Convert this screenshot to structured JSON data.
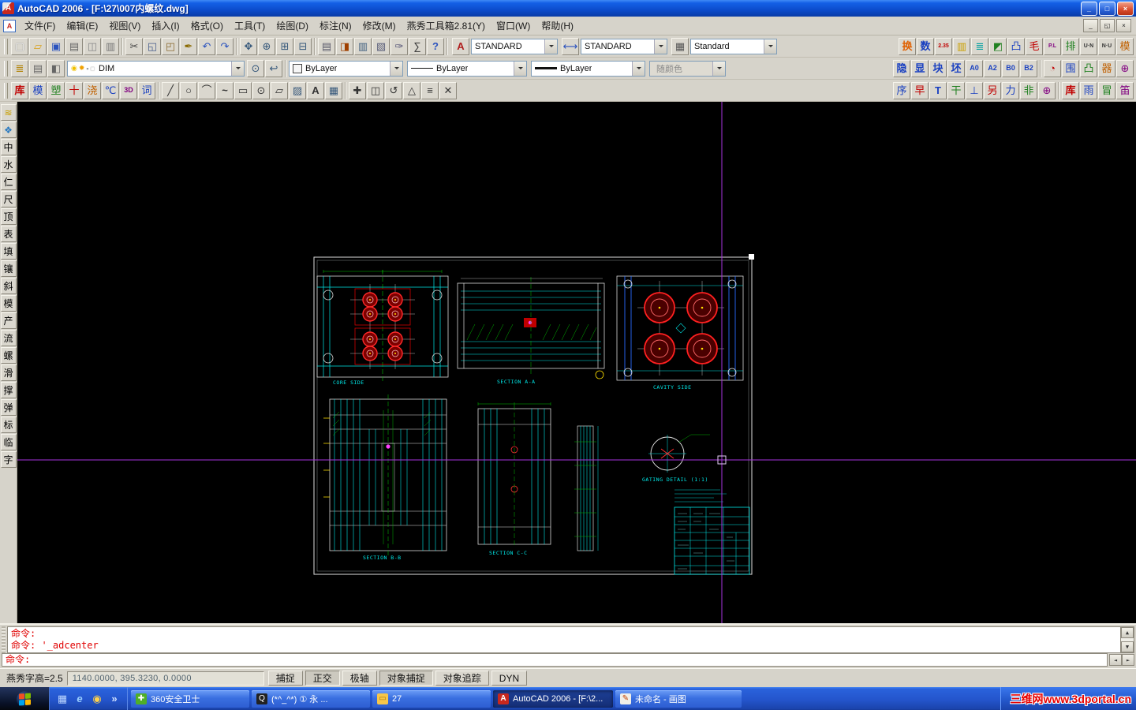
{
  "titlebar": {
    "title": "AutoCAD 2006 - [F:\\27\\007内螺纹.dwg]",
    "app_icon_letter": "A",
    "minimize": "_",
    "maximize": "□",
    "close": "×"
  },
  "menubar": {
    "items": [
      "文件(F)",
      "编辑(E)",
      "视图(V)",
      "插入(I)",
      "格式(O)",
      "工具(T)",
      "绘图(D)",
      "标注(N)",
      "修改(M)",
      "燕秀工具箱2.81(Y)",
      "窗口(W)",
      "帮助(H)"
    ],
    "doc_buttons": [
      {
        "name": "doc-minimize-button",
        "glyph": "_"
      },
      {
        "name": "doc-restore-button",
        "glyph": "◱"
      },
      {
        "name": "doc-close-button",
        "glyph": "×"
      }
    ]
  },
  "toolbars": {
    "row1": {
      "file": [
        {
          "name": "new-file-icon",
          "glyph": "▢",
          "style": "color:#fff;text-shadow:0 0 1px #444"
        },
        {
          "name": "open-folder-icon",
          "glyph": "▱",
          "style": "color:#d8a018"
        },
        {
          "name": "save-icon",
          "glyph": "▣",
          "style": "color:#2a52be"
        },
        {
          "name": "plot-icon",
          "glyph": "▤",
          "style": "color:#666"
        },
        {
          "name": "plot-preview-icon",
          "glyph": "◫",
          "style": "color:#888"
        },
        {
          "name": "publish-icon",
          "glyph": "▥",
          "style": "color:#777"
        }
      ],
      "edit": [
        {
          "name": "cut-icon",
          "glyph": "✂",
          "style": "color:#444"
        },
        {
          "name": "copy-icon",
          "glyph": "◱",
          "style": "color:#445a8a"
        },
        {
          "name": "paste-icon",
          "glyph": "◰",
          "style": "color:#8a6a30"
        },
        {
          "name": "match-properties-icon",
          "glyph": "✒",
          "style": "color:#8a6a00"
        },
        {
          "name": "undo-icon",
          "glyph": "↶",
          "style": "color:#2a52be"
        },
        {
          "name": "redo-icon",
          "glyph": "↷",
          "style": "color:#2a52be"
        }
      ],
      "zoom": [
        {
          "name": "pan-icon",
          "glyph": "✥",
          "style": "color:#35577a"
        },
        {
          "name": "zoom-realtime-icon",
          "glyph": "⊕",
          "style": "color:#35577a"
        },
        {
          "name": "zoom-window-icon",
          "glyph": "⊞",
          "style": "color:#35577a"
        },
        {
          "name": "zoom-previous-icon",
          "glyph": "⊟",
          "style": "color:#35577a"
        }
      ],
      "palettes": [
        {
          "name": "properties-palette-icon",
          "glyph": "▤",
          "style": "color:#5a5a6a"
        },
        {
          "name": "designcenter-icon",
          "glyph": "◨",
          "style": "color:#a04000"
        },
        {
          "name": "tool-palettes-icon",
          "glyph": "▥",
          "style": "color:#406080"
        },
        {
          "name": "sheet-set-manager-icon",
          "glyph": "▧",
          "style": "color:#555a77"
        },
        {
          "name": "markup-set-manager-icon",
          "glyph": "✑",
          "style": "color:#557"
        },
        {
          "name": "quickcalc-icon",
          "glyph": "∑",
          "style": "color:#333"
        },
        {
          "name": "help-icon",
          "glyph": "?",
          "style": "color:#2a52be;font-weight:bold"
        }
      ],
      "combos": [
        {
          "name": "text-style-combo",
          "icon": "text-style-icon",
          "glyph": "A",
          "istyle": "color:#b02020;font-weight:bold",
          "value": "STANDARD"
        },
        {
          "name": "dim-style-combo",
          "icon": "dim-style-icon",
          "glyph": "⟷",
          "istyle": "color:#2a52be",
          "value": "STANDARD"
        },
        {
          "name": "table-style-combo",
          "icon": "table-style-icon",
          "glyph": "▦",
          "istyle": "color:#555",
          "value": "Standard"
        }
      ],
      "yanxiu": [
        {
          "name": "yanxiu-swap-icon",
          "glyph": "换",
          "style": "color:#e06000;font-weight:bold"
        },
        {
          "name": "yanxiu-count-icon",
          "glyph": "数",
          "style": "color:#1a40c0;font-weight:bold"
        },
        {
          "name": "yanxiu-scale-icon",
          "glyph": "2.35",
          "style": "font-size:7px;color:#c00000;font-weight:bold"
        },
        {
          "name": "yanxiu-palette-icon",
          "glyph": "▥",
          "style": "color:#caa000"
        },
        {
          "name": "yanxiu-list-icon",
          "glyph": "≣",
          "style": "color:#00a0a0"
        },
        {
          "name": "yanxiu-corner-icon",
          "glyph": "◩",
          "style": "color:#208020"
        },
        {
          "name": "yanxiu-boss-icon",
          "glyph": "凸",
          "style": "color:#1a40c0"
        },
        {
          "name": "yanxiu-burr-icon",
          "glyph": "毛",
          "style": "color:#c00000"
        },
        {
          "name": "yanxiu-parting-line-icon",
          "glyph": "P.L",
          "style": "font-size:7px;color:#800080;font-weight:bold"
        },
        {
          "name": "yanxiu-layout-icon",
          "glyph": "排",
          "style": "color:#208020"
        },
        {
          "name": "yanxiu-un-icon",
          "glyph": "U·N",
          "style": "font-size:7px;color:#333;font-weight:bold"
        },
        {
          "name": "yanxiu-nu-icon",
          "glyph": "N·U",
          "style": "font-size:7px;color:#333;font-weight:bold"
        },
        {
          "name": "yanxiu-mold-icon",
          "glyph": "模",
          "style": "color:#c06000"
        }
      ]
    },
    "row2": {
      "layer_tools": [
        {
          "name": "layer-properties-manager-icon",
          "glyph": "≣",
          "style": "color:#b08000"
        },
        {
          "name": "layer-states-icon",
          "glyph": "▤",
          "style": "color:#666"
        },
        {
          "name": "layer-filter-icon",
          "glyph": "◧",
          "style": "color:#666"
        }
      ],
      "layer_combo": {
        "value": "DIM",
        "icons": [
          {
            "name": "layer-on-icon",
            "glyph": "◉",
            "style": "color:#f0c000"
          },
          {
            "name": "layer-freeze-icon",
            "glyph": "✹",
            "style": "color:#f0a000"
          },
          {
            "name": "layer-lock-icon",
            "glyph": "▪",
            "style": "color:#98a0a8"
          },
          {
            "name": "layer-color-chip",
            "glyph": "■",
            "style": "color:#fdfdfd;text-shadow:0 0 1px #333"
          }
        ]
      },
      "post_icons": [
        {
          "name": "make-object-layer-current-icon",
          "glyph": "⊙",
          "style": "color:#35577a"
        },
        {
          "name": "layer-previous-icon",
          "glyph": "↩",
          "style": "color:#35577a"
        }
      ],
      "prop_combos": [
        {
          "name": "color-combo",
          "chip": "",
          "chipstyle": "width:10px;height:10px;background:#f6f6f6;border:1px solid #444",
          "value": "ByLayer",
          "w": "width:145px",
          "state": "normal"
        },
        {
          "name": "linetype-combo",
          "chip": "",
          "chipstyle": "width:28px;height:0;border-top:1px solid #111",
          "value": "ByLayer",
          "w": "width:152px",
          "state": "normal"
        },
        {
          "name": "lineweight-combo",
          "chip": "",
          "chipstyle": "width:28px;height:3px;background:#111",
          "value": "ByLayer",
          "w": "width:145px",
          "state": "normal"
        },
        {
          "name": "plot-style-combo",
          "chip": "",
          "chipstyle": "width:0;height:0",
          "value": "随颜色",
          "w": "width:97px",
          "state": "disabled"
        }
      ],
      "yanxiu_text": [
        {
          "name": "yanxiu-hide-icon",
          "glyph": "隐",
          "style": "color:#1a40c0;font-weight:bold"
        },
        {
          "name": "yanxiu-show-icon",
          "glyph": "显",
          "style": "color:#1a40c0;font-weight:bold"
        },
        {
          "name": "yanxiu-block-icon",
          "glyph": "块",
          "style": "color:#1a40c0;font-weight:bold"
        },
        {
          "name": "yanxiu-blank-icon",
          "glyph": "坯",
          "style": "color:#1a40c0;font-weight:bold"
        },
        {
          "name": "yanxiu-a0-icon",
          "glyph": "A0",
          "style": "font-size:9px;color:#1a40c0;font-weight:bold"
        },
        {
          "name": "yanxiu-a2-icon",
          "glyph": "A2",
          "style": "font-size:9px;color:#1a40c0;font-weight:bold"
        },
        {
          "name": "yanxiu-b0-icon",
          "glyph": "B0",
          "style": "font-size:9px;color:#1a40c0;font-weight:bold"
        },
        {
          "name": "yanxiu-b2-icon",
          "glyph": "B2",
          "style": "font-size:9px;color:#1a40c0;font-weight:bold"
        }
      ],
      "yanxiu_icons": [
        {
          "name": "yanxiu-gauge-icon",
          "glyph": "◔",
          "style": "color:#c00000"
        },
        {
          "name": "yanxiu-frame-icon",
          "glyph": "围",
          "style": "color:#1a40c0"
        },
        {
          "name": "yanxiu-boss2-icon",
          "glyph": "凸",
          "style": "color:#208020"
        },
        {
          "name": "yanxiu-part-icon",
          "glyph": "器",
          "style": "color:#c06000"
        },
        {
          "name": "yanxiu-target-icon",
          "glyph": "⊕",
          "style": "color:#800080"
        }
      ]
    },
    "row3": {
      "yx_left": [
        {
          "name": "yanxiu-library-icon",
          "glyph": "库",
          "style": "color:#c00000;font-weight:bold"
        },
        {
          "name": "yanxiu-moldbase-icon",
          "glyph": "模",
          "style": "color:#1a40c0"
        },
        {
          "name": "yanxiu-plastic-icon",
          "glyph": "塑",
          "style": "color:#208020"
        },
        {
          "name": "yanxiu-cross-icon",
          "glyph": "十",
          "style": "color:#c00000"
        },
        {
          "name": "yanxiu-gate-icon",
          "glyph": "浇",
          "style": "color:#c06000"
        },
        {
          "name": "yanxiu-temp-icon",
          "glyph": "℃",
          "style": "color:#1a40c0"
        },
        {
          "name": "yanxiu-3d-icon",
          "glyph": "3D",
          "style": "font-size:9px;color:#800080;font-weight:bold"
        },
        {
          "name": "yanxiu-word-icon",
          "glyph": "词",
          "style": "color:#1a40c0"
        }
      ],
      "draw": [
        {
          "name": "line-tool-icon",
          "glyph": "╱",
          "style": "color:#333"
        },
        {
          "name": "circle-tool-icon",
          "glyph": "○",
          "style": "color:#333"
        },
        {
          "name": "arc-tool-icon",
          "glyph": "⌒",
          "style": "color:#333"
        },
        {
          "name": "polyline-tool-icon",
          "glyph": "~",
          "style": "color:#333;font-weight:bold"
        },
        {
          "name": "rectangle-tool-icon",
          "glyph": "▭",
          "style": "color:#333"
        },
        {
          "name": "donut-tool-icon",
          "glyph": "⊙",
          "style": "color:#333"
        },
        {
          "name": "polygon-tool-icon",
          "glyph": "▱",
          "style": "color:#333"
        },
        {
          "name": "hatch-tool-icon",
          "glyph": "▨",
          "style": "color:#35577a"
        },
        {
          "name": "text-tool-icon",
          "glyph": "A",
          "style": "color:#333;font-weight:bold"
        },
        {
          "name": "block-insert-icon",
          "glyph": "▦",
          "style": "color:#35577a"
        }
      ],
      "modify": [
        {
          "name": "move-tool-icon",
          "glyph": "✚",
          "style": "color:#333"
        },
        {
          "name": "copy-tool-icon",
          "glyph": "◫",
          "style": "color:#333"
        },
        {
          "name": "rotate-tool-icon",
          "glyph": "↺",
          "style": "color:#333"
        },
        {
          "name": "mirror-tool-icon",
          "glyph": "△",
          "style": "color:#333"
        },
        {
          "name": "offset-tool-icon",
          "glyph": "≡",
          "style": "color:#333"
        },
        {
          "name": "erase-tool-icon",
          "glyph": "✕",
          "style": "color:#333"
        }
      ],
      "yx_right": [
        {
          "name": "yanxiu-seq-icon",
          "glyph": "序",
          "style": "color:#1a40c0"
        },
        {
          "name": "yanxiu-early-icon",
          "glyph": "早",
          "style": "color:#c00000"
        },
        {
          "name": "yanxiu-t-icon",
          "glyph": "T",
          "style": "color:#1a40c0;font-weight:bold"
        },
        {
          "name": "yanxiu-dry-icon",
          "glyph": "干",
          "style": "color:#208020"
        },
        {
          "name": "yanxiu-perp-icon",
          "glyph": "⊥",
          "style": "color:#1a40c0"
        },
        {
          "name": "yanxiu-other-icon",
          "glyph": "另",
          "style": "color:#c00000"
        },
        {
          "name": "yanxiu-force-icon",
          "glyph": "力",
          "style": "color:#1a40c0"
        },
        {
          "name": "yanxiu-not-icon",
          "glyph": "非",
          "style": "color:#208020"
        },
        {
          "name": "yanxiu-circle-plus-icon",
          "glyph": "⊕",
          "style": "color:#800080"
        }
      ],
      "yx_far": [
        {
          "name": "yanxiu-library2-icon",
          "glyph": "库",
          "style": "color:#c00000;font-weight:bold"
        },
        {
          "name": "yanxiu-rain-icon",
          "glyph": "雨",
          "style": "color:#1a40c0"
        },
        {
          "name": "yanxiu-cap-icon",
          "glyph": "冒",
          "style": "color:#208020"
        },
        {
          "name": "yanxiu-flute-icon",
          "glyph": "笛",
          "style": "color:#800080"
        }
      ]
    }
  },
  "sidebar": {
    "top_icons": [
      {
        "name": "sidebar-layers-icon",
        "glyph": "≋",
        "style": "color:#c8a000"
      },
      {
        "name": "sidebar-tools-icon",
        "glyph": "❖",
        "style": "color:#2a7ac0"
      }
    ],
    "chars": [
      "中",
      "水",
      "仁",
      "尺",
      "顶",
      "表",
      "填",
      "镶",
      "斜",
      "模",
      "产",
      "流",
      "螺",
      "滑",
      "撑",
      "弹",
      "标",
      "临",
      "字"
    ]
  },
  "drawing": {
    "labels": {
      "view1": "CORE SIDE",
      "view2": "SECTION A-A",
      "view3": "CAVITY SIDE",
      "view4": "SECTION B-B",
      "view5": "SECTION C-C",
      "detail": "GATING DETAIL (1:1)"
    },
    "crosshair_color": "#a833e0"
  },
  "command": {
    "lines": [
      "命令:",
      "命令: '_adcenter",
      "命令:"
    ]
  },
  "statusbar": {
    "left_text": "燕秀字高=2.5",
    "coords": "1140.0000,  395.3230,  0.0000",
    "toggles": [
      {
        "name": "snap-toggle",
        "label": "捕捉",
        "state": "off"
      },
      {
        "name": "ortho-toggle",
        "label": "正交",
        "state": "on"
      },
      {
        "name": "polar-toggle",
        "label": "极轴",
        "state": "off"
      },
      {
        "name": "osnap-toggle",
        "label": "对象捕捉",
        "state": "on"
      },
      {
        "name": "otrack-toggle",
        "label": "对象追踪",
        "state": "off"
      },
      {
        "name": "dyn-toggle",
        "label": "DYN",
        "state": "off"
      }
    ]
  },
  "taskbar": {
    "quick_launch": [
      {
        "name": "show-desktop-icon",
        "glyph": "▦",
        "style": "color:#bcd6ff"
      },
      {
        "name": "internet-explorer-icon",
        "glyph": "e",
        "style": "color:#9ad0ff;font-style:italic;font-weight:bold"
      },
      {
        "name": "media-player-icon",
        "glyph": "◉",
        "style": "color:#ffd24a"
      },
      {
        "name": "quick-launch-expand-icon",
        "glyph": "»",
        "style": "color:#cfe0ff;font-weight:bold"
      }
    ],
    "tasks": [
      {
        "name": "task-360-safety",
        "icon": "shield-icon",
        "iconglyph": "✚",
        "iconstyle": "background:#4fae28;color:#fff",
        "label": "360安全卫士",
        "state": "normal",
        "w": "width:150px"
      },
      {
        "name": "task-qq",
        "icon": "qq-penguin-icon",
        "iconglyph": "Q",
        "iconstyle": "background:#222;color:#fff",
        "label": "(*^_^*) ① 永 ...",
        "state": "normal",
        "w": "width:150px"
      },
      {
        "name": "task-folder-27",
        "icon": "folder-icon",
        "iconglyph": "▭",
        "iconstyle": "background:#f7c64a;color:#a97608",
        "label": "27",
        "state": "normal",
        "w": "width:150px"
      },
      {
        "name": "task-autocad",
        "icon": "autocad-icon",
        "iconglyph": "A",
        "iconstyle": "background:#c8281e;color:#fff;font-weight:bold",
        "label": "AutoCAD 2006 - [F:\\2...",
        "state": "active",
        "w": "width:152px"
      },
      {
        "name": "task-mspaint",
        "icon": "paint-icon",
        "iconglyph": "✎",
        "iconstyle": "background:#f0efe8;color:#c04000",
        "label": "未命名 - 画图",
        "state": "normal",
        "w": "width:160px"
      }
    ],
    "tray_text": "三维网www.3dportal.cn"
  }
}
